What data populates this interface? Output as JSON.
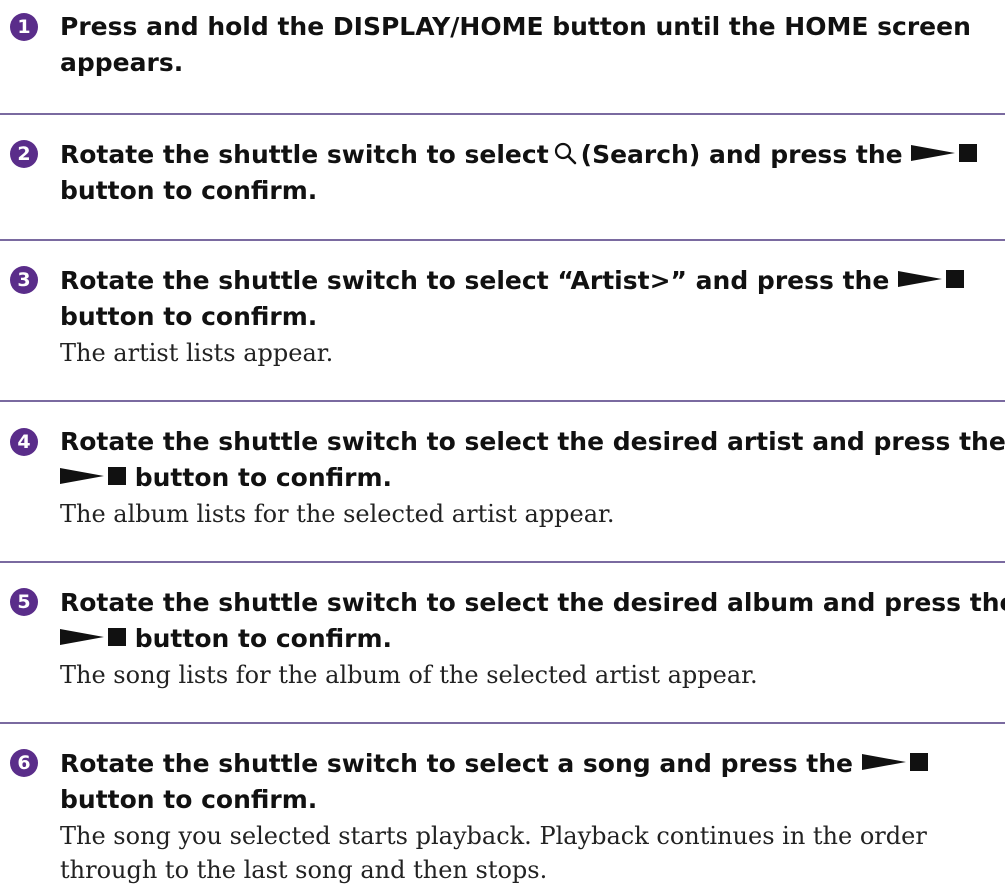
{
  "colors": {
    "accent": "#5a2d8a",
    "rule": "#7a6aa0"
  },
  "icons": {
    "search": "search-icon",
    "play_stop": "play-stop-icon"
  },
  "steps": [
    {
      "num": "1",
      "line1": "Press and hold the DISPLAY/HOME button until the HOME screen",
      "line2": "appears."
    },
    {
      "num": "2",
      "line1_a": "Rotate the shuttle switch to select",
      "line1_b": "(Search) and press the",
      "line2": "button to confirm."
    },
    {
      "num": "3",
      "line1": "Rotate the shuttle switch to select “Artist>” and press the",
      "line2": "button to confirm.",
      "body": "The artist lists appear."
    },
    {
      "num": "4",
      "line1": "Rotate the shuttle switch to select the desired artist and press the",
      "line2": "button to confirm.",
      "body": "The album lists for the selected artist appear."
    },
    {
      "num": "5",
      "line1": "Rotate the shuttle switch to select the desired album and press the",
      "line2": "button to confirm.",
      "body": "The song lists for the album of the selected artist appear."
    },
    {
      "num": "6",
      "line1": "Rotate the shuttle switch to select a song and press the",
      "line2": "button to confirm.",
      "body1": "The song you selected starts playback. Playback continues in the order",
      "body2": "through to the last song and then stops."
    }
  ]
}
